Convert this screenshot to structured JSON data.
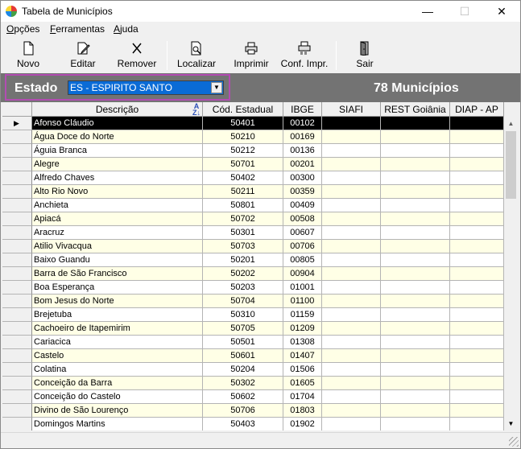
{
  "window": {
    "title": "Tabela de Municípios",
    "min": "—",
    "max": "☐",
    "close": "✕"
  },
  "menu": [
    {
      "first": "O",
      "rest": "pções"
    },
    {
      "first": "F",
      "rest": "erramentas"
    },
    {
      "first": "A",
      "rest": "juda"
    }
  ],
  "toolbar": {
    "novo": "Novo",
    "editar": "Editar",
    "remover": "Remover",
    "localizar": "Localizar",
    "imprimir": "Imprimir",
    "conf": "Conf. Impr.",
    "sair": "Sair"
  },
  "estado": {
    "label": "Estado",
    "selected": "ES - ESPIRITO SANTO",
    "count": "78 Municípios"
  },
  "columns": [
    "Descrição",
    "Cód. Estadual",
    "IBGE",
    "SIAFI",
    "REST Goiânia",
    "DIAP - AP"
  ],
  "rows": [
    [
      "Afonso Cláudio",
      "50401",
      "00102"
    ],
    [
      "Água Doce do Norte",
      "50210",
      "00169"
    ],
    [
      "Águia Branca",
      "50212",
      "00136"
    ],
    [
      "Alegre",
      "50701",
      "00201"
    ],
    [
      "Alfredo Chaves",
      "50402",
      "00300"
    ],
    [
      "Alto Rio Novo",
      "50211",
      "00359"
    ],
    [
      "Anchieta",
      "50801",
      "00409"
    ],
    [
      "Apiacá",
      "50702",
      "00508"
    ],
    [
      "Aracruz",
      "50301",
      "00607"
    ],
    [
      "Atilio Vivacqua",
      "50703",
      "00706"
    ],
    [
      "Baixo Guandu",
      "50201",
      "00805"
    ],
    [
      "Barra de São Francisco",
      "50202",
      "00904"
    ],
    [
      "Boa Esperança",
      "50203",
      "01001"
    ],
    [
      "Bom Jesus do Norte",
      "50704",
      "01100"
    ],
    [
      "Brejetuba",
      "50310",
      "01159"
    ],
    [
      "Cachoeiro de Itapemirim",
      "50705",
      "01209"
    ],
    [
      "Cariacica",
      "50501",
      "01308"
    ],
    [
      "Castelo",
      "50601",
      "01407"
    ],
    [
      "Colatina",
      "50204",
      "01506"
    ],
    [
      "Conceição da Barra",
      "50302",
      "01605"
    ],
    [
      "Conceição do Castelo",
      "50602",
      "01704"
    ],
    [
      "Divino de São Lourenço",
      "50706",
      "01803"
    ],
    [
      "Domingos Martins",
      "50403",
      "01902"
    ]
  ]
}
